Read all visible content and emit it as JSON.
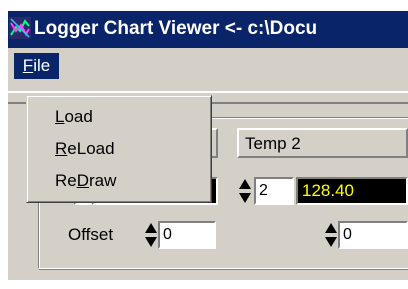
{
  "window": {
    "title": "Logger Chart Viewer <- c:\\Docu"
  },
  "menubar": {
    "file_label": "File",
    "file_mnemonic": "F",
    "file_rest": "ile"
  },
  "file_menu": {
    "items": [
      {
        "label": "Load",
        "pre": "",
        "mnemonic": "L",
        "post": "oad"
      },
      {
        "label": "ReLoad",
        "pre": "",
        "mnemonic": "R",
        "post": "eLoad"
      },
      {
        "label": "ReDraw",
        "pre": "Re",
        "mnemonic": "D",
        "post": "raw"
      }
    ]
  },
  "columns": [
    {
      "header": "",
      "channel": "",
      "value": "",
      "offset_label": "Offset",
      "offset_value": "0"
    },
    {
      "header": "Temp 2",
      "channel": "2",
      "value": "128.40",
      "offset_label": "",
      "offset_value": "0"
    }
  ],
  "colors": {
    "titlebar": "#0a246a",
    "face": "#d4d0c8",
    "readout_bg": "#000000",
    "readout_text": "#ffff00"
  },
  "icons": {
    "app": "chart-logo-icon",
    "spinner": "spin-up-down-icon"
  }
}
